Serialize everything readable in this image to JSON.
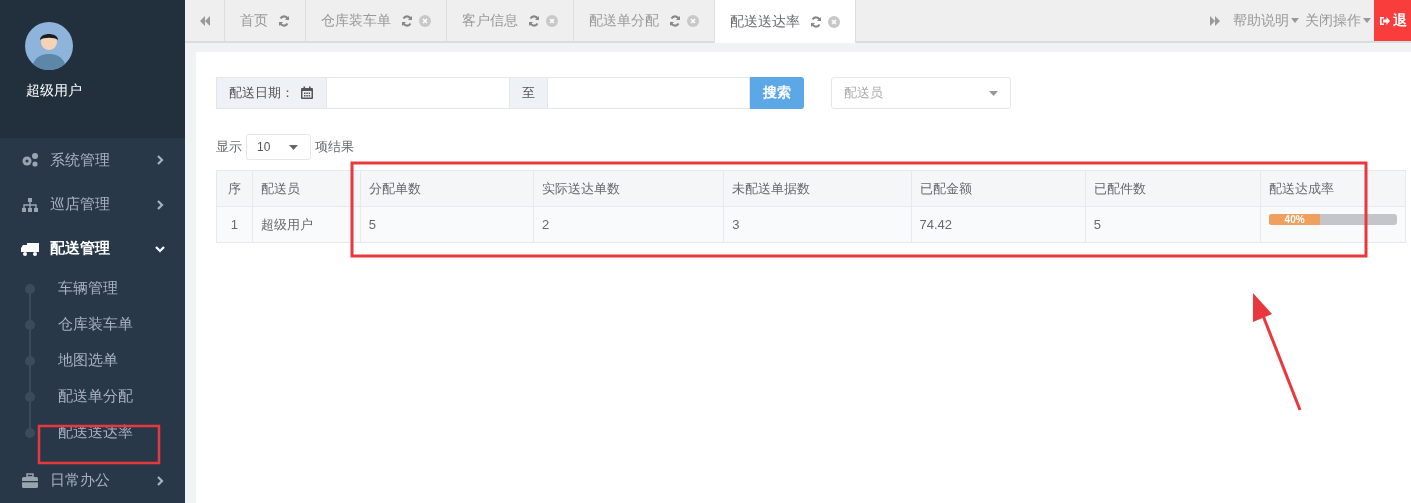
{
  "sidebar": {
    "user_name": "超级用户",
    "menu": [
      {
        "label": "系统管理",
        "expanded": false
      },
      {
        "label": "巡店管理",
        "expanded": false
      },
      {
        "label": "配送管理",
        "expanded": true,
        "children": [
          {
            "label": "车辆管理"
          },
          {
            "label": "仓库装车单"
          },
          {
            "label": "地图选单"
          },
          {
            "label": "配送单分配"
          },
          {
            "label": "配送送达率"
          }
        ]
      },
      {
        "label": "日常办公",
        "expanded": false
      }
    ]
  },
  "tabs": [
    {
      "label": "首页",
      "selected": false,
      "closable": false
    },
    {
      "label": "仓库装车单",
      "selected": false,
      "closable": true
    },
    {
      "label": "客户信息",
      "selected": false,
      "closable": true
    },
    {
      "label": "配送单分配",
      "selected": false,
      "closable": true
    },
    {
      "label": "配送送达率",
      "selected": true,
      "closable": true
    }
  ],
  "top_menus": [
    "帮助说明",
    "关闭操作"
  ],
  "logout": "退",
  "filters": {
    "date_label": "配送日期：",
    "range_separator": "至",
    "search_button": "搜索",
    "courier_select": {
      "placeholder": "配送员"
    }
  },
  "page_size": {
    "prefix": "显示",
    "value": "10",
    "suffix": "项结果"
  },
  "table": {
    "columns": [
      "序",
      "配送员",
      "分配单数",
      "实际送达单数",
      "未配送单据数",
      "已配金额",
      "已配件数",
      "配送达成率"
    ],
    "rows": [
      {
        "cells": [
          "1",
          "超级用户",
          "5",
          "2",
          "3",
          "74.42",
          "5"
        ],
        "rate": {
          "label": "40%",
          "level": 0.4
        }
      }
    ]
  }
}
